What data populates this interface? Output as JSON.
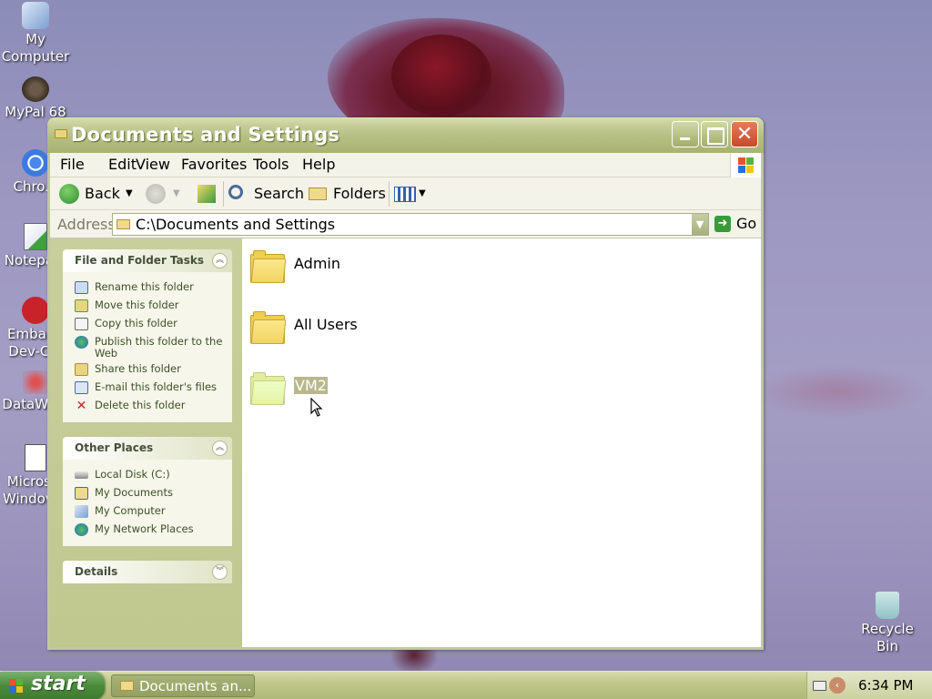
{
  "desktop": {
    "icons": [
      {
        "label": "My\nComputer"
      },
      {
        "label": "MyPal 68"
      },
      {
        "label": "Chro..."
      },
      {
        "label": "Notepa..."
      },
      {
        "label": "Embar...\nDev-C..."
      },
      {
        "label": "DataWa..."
      },
      {
        "label": "Micros...\nWindow..."
      },
      {
        "label": "Recycle\nBin"
      }
    ],
    "icon_labels": {
      "my_computer_1": "My",
      "my_computer_2": "Computer",
      "mypal": "MyPal 68",
      "chrome": "Chro...",
      "notepad": "Notepa...",
      "embar_1": "Embar...",
      "embar_2": "Dev-C...",
      "datawa": "DataWa...",
      "micros_1": "Micros...",
      "micros_2": "Window...",
      "recycle_1": "Recycle",
      "recycle_2": "Bin"
    }
  },
  "window": {
    "title": "Documents and Settings",
    "menu": [
      "File",
      "Edit",
      "View",
      "Favorites",
      "Tools",
      "Help"
    ],
    "toolbar": {
      "back": "Back",
      "search": "Search",
      "folders": "Folders"
    },
    "address": {
      "label": "Address",
      "value": "C:\\Documents and Settings",
      "go": "Go"
    },
    "file_folder_tasks": {
      "title": "File and Folder Tasks",
      "items": [
        "Rename this folder",
        "Move this folder",
        "Copy this folder",
        "Publish this folder to the Web",
        "Share this folder",
        "E-mail this folder's files",
        "Delete this folder"
      ]
    },
    "other_places": {
      "title": "Other Places",
      "items": [
        "Local Disk (C:)",
        "My Documents",
        "My Computer",
        "My Network Places"
      ]
    },
    "details": {
      "title": "Details"
    },
    "folders": [
      {
        "name": "Admin",
        "selected": false
      },
      {
        "name": "All Users",
        "selected": false
      },
      {
        "name": "VM2",
        "selected": true
      }
    ]
  },
  "taskbar": {
    "start": "start",
    "task_label": "Documents an...",
    "clock": "6:34 PM"
  },
  "colors": {
    "title_bar": "#b5bf82",
    "task_link": "#3c4f27",
    "start_button": "#4a8b3a",
    "selected_item": "#b8b88c"
  }
}
